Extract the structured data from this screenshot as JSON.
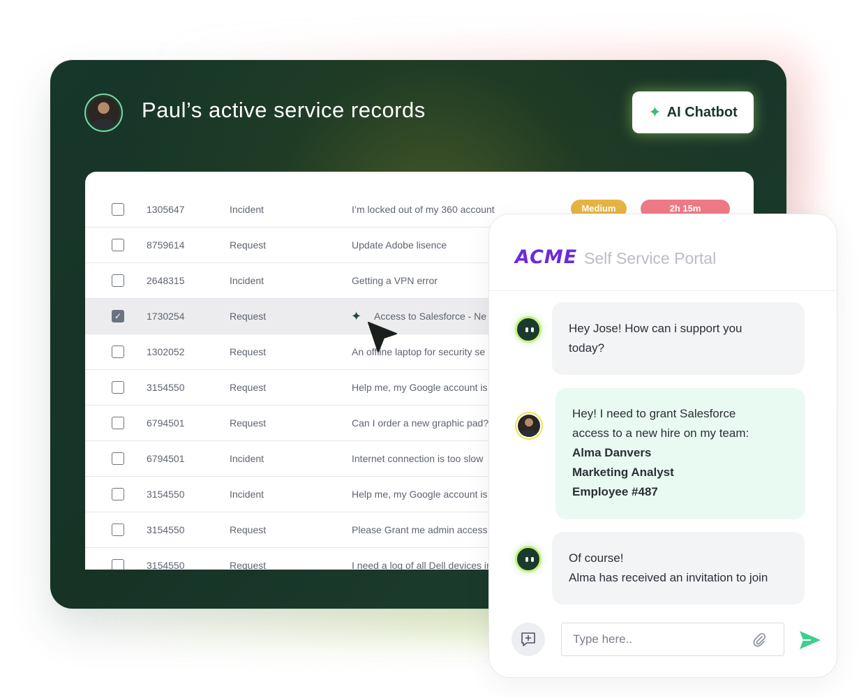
{
  "header": {
    "title": "Paul’s active service records",
    "ai_button_label": "AI Chatbot",
    "ai_button_icon": "sparkle-icon"
  },
  "table": {
    "rows": [
      {
        "id": "1305647",
        "type": "Incident",
        "desc": "I’m locked out of my 360 account",
        "checked": false,
        "priority": "Medium",
        "time": "2h 15m"
      },
      {
        "id": "8759614",
        "type": "Request",
        "desc": "Update Adobe lisence",
        "checked": false
      },
      {
        "id": "2648315",
        "type": "Incident",
        "desc": "Getting a VPN error",
        "checked": false
      },
      {
        "id": "1730254",
        "type": "Request",
        "desc": "Access to Salesforce - Ne",
        "checked": true
      },
      {
        "id": "1302052",
        "type": "Request",
        "desc": "An offline laptop for security se",
        "checked": false
      },
      {
        "id": "3154550",
        "type": "Request",
        "desc": "Help me, my Google account is",
        "checked": false
      },
      {
        "id": "6794501",
        "type": "Request",
        "desc": "Can I order a new graphic pad?",
        "checked": false
      },
      {
        "id": "6794501",
        "type": "Incident",
        "desc": "Internet connection is too slow",
        "checked": false
      },
      {
        "id": "3154550",
        "type": "Incident",
        "desc": "Help me, my Google account is",
        "checked": false
      },
      {
        "id": "3154550",
        "type": "Request",
        "desc": "Please Grant me admin access t",
        "checked": false
      },
      {
        "id": "3154550",
        "type": "Request",
        "desc": "I need a log of all Dell devices ir",
        "checked": false
      }
    ]
  },
  "chat": {
    "brand": "ACME",
    "portal_title": "Self Service Portal",
    "messages": [
      {
        "from": "bot",
        "lines": [
          "Hey Jose! How can i support you",
          "today?"
        ]
      },
      {
        "from": "user",
        "lines": [
          "Hey! I need to grant Salesforce",
          "access to a new hire on my team:"
        ],
        "bold_lines": [
          "Alma Danvers",
          "Marketing Analyst",
          "Employee #487"
        ]
      },
      {
        "from": "bot",
        "lines": [
          "Of course!",
          "Alma has received an invitation to join"
        ]
      }
    ],
    "input_placeholder": "Type here..",
    "colors": {
      "brand": "#6b2bd9",
      "user_bubble": "#e9faf2",
      "bot_bubble": "#f3f4f6",
      "send": "#3fcf8e"
    }
  }
}
